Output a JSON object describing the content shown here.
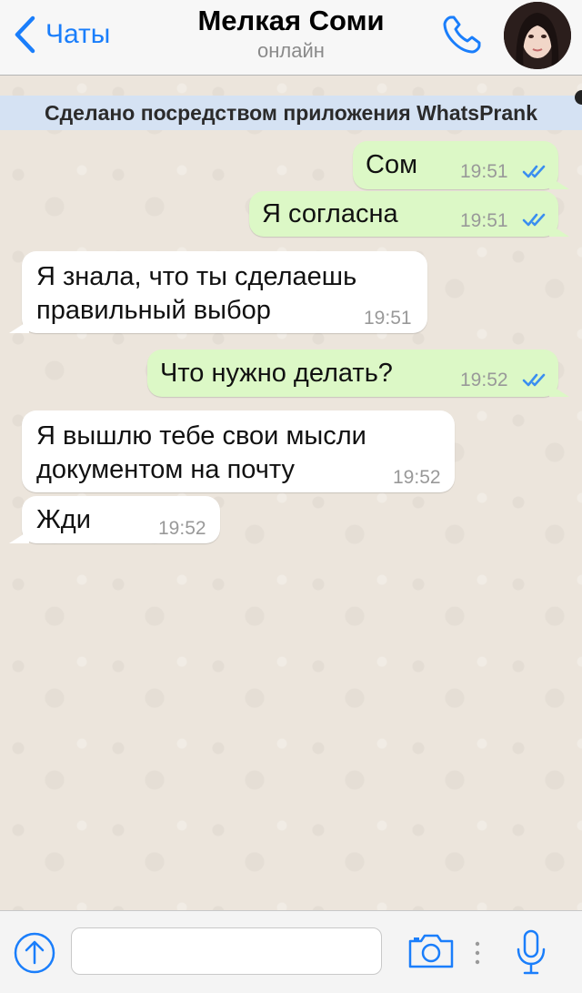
{
  "header": {
    "back_label": "Чаты",
    "title": "Мелкая Соми",
    "subtitle": "онлайн"
  },
  "banner": {
    "text": "Сделано посредством приложения WhatsPrank"
  },
  "messages": [
    {
      "direction": "out",
      "text": "Сом",
      "time": "19:51",
      "read": true
    },
    {
      "direction": "out",
      "text": "Я согласна",
      "time": "19:51",
      "read": true
    },
    {
      "direction": "in",
      "text": "Я знала, что ты сделаешь правильный выбор",
      "time": "19:51"
    },
    {
      "direction": "out",
      "text": "Что нужно делать?",
      "time": "19:52",
      "read": true
    },
    {
      "direction": "in",
      "text": "Я вышлю тебе свои мысли документом на почту",
      "time": "19:52"
    },
    {
      "direction": "in",
      "text": "Жди",
      "time": "19:52"
    }
  ],
  "input": {
    "value": "",
    "placeholder": ""
  },
  "icons": {
    "back": "chevron-left-icon",
    "call": "phone-icon",
    "upload": "upload-arrow-icon",
    "camera": "camera-icon",
    "more": "vertical-dots-icon",
    "mic": "microphone-icon"
  },
  "colors": {
    "accent": "#1a7efb",
    "outgoing_bubble": "#dcf8c6",
    "incoming_bubble": "#ffffff",
    "chat_background": "#ece5dc",
    "banner_background": "#d5e2f3",
    "read_ticks": "#3a8ef0"
  }
}
